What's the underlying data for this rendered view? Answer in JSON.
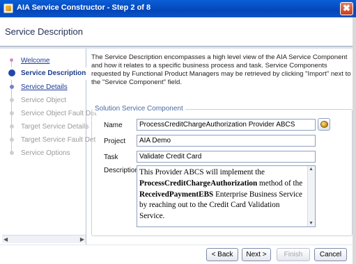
{
  "window": {
    "title": "AIA Service Constructor - Step 2 of 8",
    "close_glyph": "✖"
  },
  "header": {
    "title": "Service Description"
  },
  "nav": {
    "items": [
      {
        "label": "Welcome",
        "state": "link"
      },
      {
        "label": "Service Description",
        "state": "active"
      },
      {
        "label": "Service Details",
        "state": "link"
      },
      {
        "label": "Service Object",
        "state": "disabled"
      },
      {
        "label": "Service Object Fault Det",
        "state": "disabled"
      },
      {
        "label": "Target Service Details",
        "state": "disabled"
      },
      {
        "label": "Target Service Fault Det",
        "state": "disabled"
      },
      {
        "label": "Service Options",
        "state": "disabled"
      }
    ]
  },
  "intro_text": "The Service Description encompasses a high level view of the AIA Service Component and how it relates to a specific business process and task. Service Components requested by Functional Product Managers may be retrieved by clicking \"Import\" next to the \"Service Component\" field.",
  "section": {
    "legend": "Solution Service Component",
    "name_label": "Name",
    "name_value": "ProcessCreditChargeAuthorization Provider ABCS",
    "project_label": "Project",
    "project_value": "AIA Demo",
    "task_label": "Task",
    "task_value": "Validate Credit Card",
    "description_label": "Description",
    "description": {
      "p1": "This Provider ABCS will implement the ",
      "b1": "ProcessCreditChargeAuthorization",
      "p2": " method of the ",
      "b2": "ReceivedPaymentEBS",
      "p3": " Enterprise Business Service by reaching out to the Credit Card Validation Service."
    }
  },
  "buttons": {
    "back": "< Back",
    "next": "Next >",
    "finish": "Finish",
    "cancel": "Cancel"
  },
  "icons": {
    "import": "import-service-icon"
  }
}
